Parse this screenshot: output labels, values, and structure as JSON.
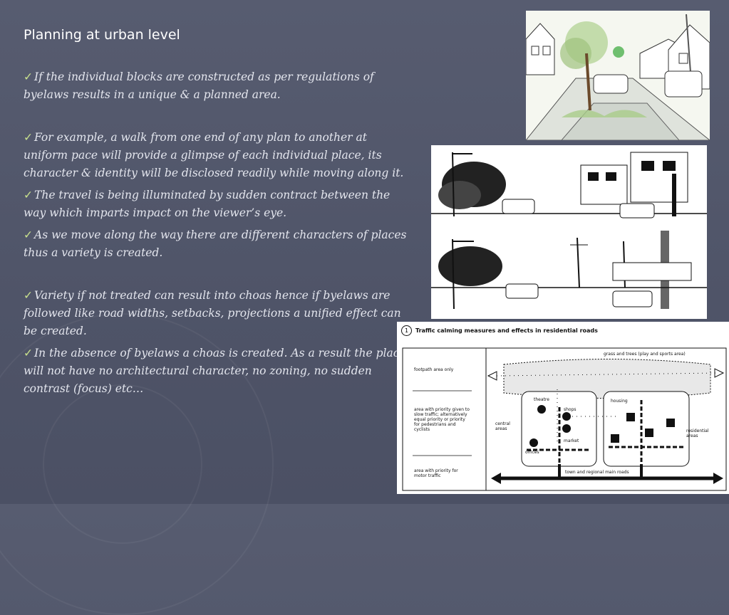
{
  "slide": {
    "title": "Planning at urban level",
    "bullets": [
      "If the individual blocks are constructed as per regulations of byelaws results in a unique & a planned area.",
      "For example, a walk from one end of any plan to another at uniform pace will provide a glimpse of each individual place, its character & identity will be disclosed readily while moving along it.",
      "The travel is being illuminated by sudden contract between the way which imparts impact on the viewer’s eye.",
      "As we move along the way there are different characters of places thus a variety is created.",
      "Variety if not treated can result into choas hence if byelaws are followed like road widths, setbacks, projections a unified effect can be created.",
      "In the absence of byelaws a choas is created. As a result the place will not have no architectural character, no zoning, no sudden contrast (focus) etc…"
    ],
    "check_glyph": "✓"
  },
  "diagram": {
    "number": "1",
    "title": "Traffic calming measures and effects in residential roads",
    "legend": [
      "footpath area only",
      "area with priority given to slow traffic; alternatively equal priority or priority for pedestrians and cyclists",
      "area with priority for motor traffic"
    ],
    "labels": {
      "grass": "grass and trees (play and sports area)",
      "theatre": "theatre",
      "shops": "shops",
      "housing": "housing",
      "central": "central areas",
      "residential": "residential areas",
      "market": "market",
      "offices": "offices",
      "roads": "town and regional main roads"
    }
  },
  "colors": {
    "background": "#535869",
    "check": "#c8e08c",
    "text": "#e4e6ee"
  }
}
